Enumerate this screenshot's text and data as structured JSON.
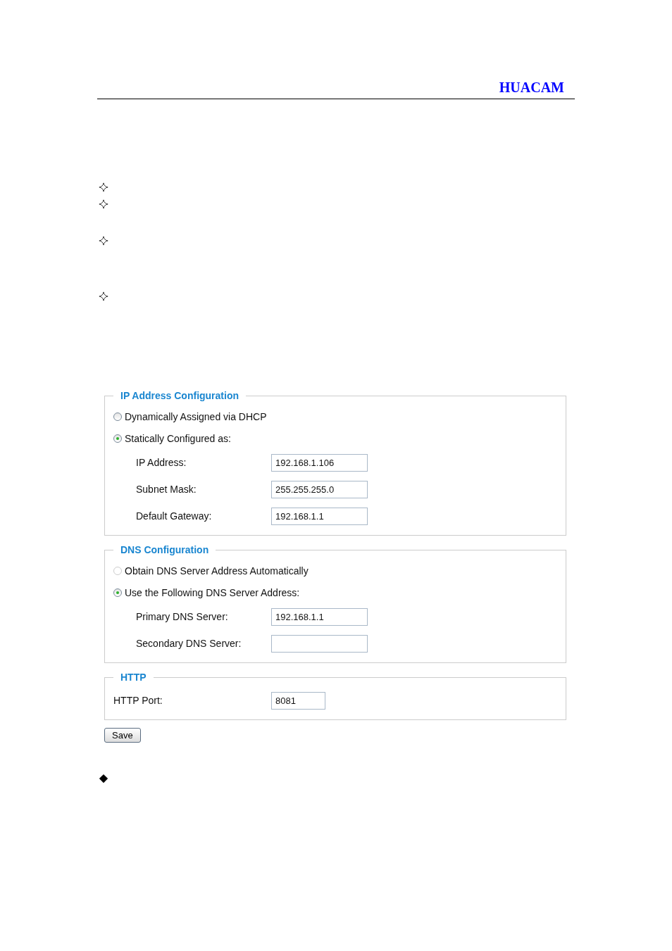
{
  "header": {
    "brand": "HUACAM"
  },
  "markers": [
    {
      "kind": "star"
    },
    {
      "kind": "star"
    },
    {
      "kind": "star"
    },
    {
      "kind": "star"
    }
  ],
  "sections": [
    {
      "title": "IP Address Configuration",
      "options": [
        {
          "label": "Dynamically Assigned via DHCP",
          "selected": false,
          "disabled": false
        },
        {
          "label": "Statically Configured as:",
          "selected": true,
          "disabled": false
        }
      ],
      "fields": [
        {
          "label": "IP Address:",
          "value": "192.168.1.106"
        },
        {
          "label": "Subnet Mask:",
          "value": "255.255.255.0"
        },
        {
          "label": "Default Gateway:",
          "value": "192.168.1.1"
        }
      ]
    },
    {
      "title": "DNS Configuration",
      "options": [
        {
          "label": "Obtain DNS Server Address Automatically",
          "selected": false,
          "disabled": true
        },
        {
          "label": "Use the Following DNS Server Address:",
          "selected": true,
          "disabled": false
        }
      ],
      "fields": [
        {
          "label": "Primary DNS Server:",
          "value": "192.168.1.1"
        },
        {
          "label": "Secondary DNS Server:"
        }
      ]
    },
    {
      "title": "HTTP",
      "fields": [
        {
          "label": "HTTP Port:",
          "value": "8081"
        }
      ]
    }
  ],
  "save_button": "Save",
  "footer_markers": [
    {
      "kind": "diamond"
    }
  ]
}
